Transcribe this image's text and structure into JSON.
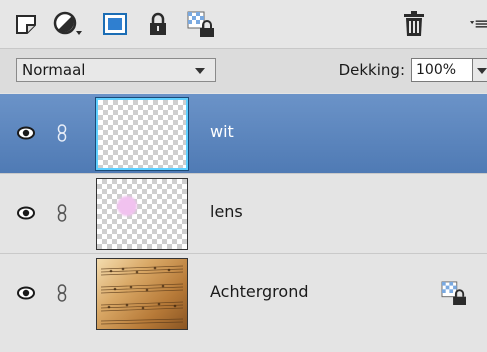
{
  "toolbar": {
    "icons": [
      "new-layer-icon",
      "adjustment-layer-icon",
      "layer-mask-icon",
      "lock-all-icon",
      "lock-transparency-icon",
      "delete-layer-icon",
      "panel-menu-icon"
    ]
  },
  "options": {
    "blend_mode": "Normaal",
    "opacity_label": "Dekking:",
    "opacity_value": "100%"
  },
  "layers": [
    {
      "name": "wit",
      "selected": true,
      "visible": true,
      "thumbnail": "transparent"
    },
    {
      "name": "lens",
      "selected": false,
      "visible": true,
      "thumbnail": "transparent-with-pink-spot"
    },
    {
      "name": "Achtergrond",
      "selected": false,
      "visible": true,
      "thumbnail": "sheet-music-photo",
      "locked": true
    }
  ],
  "colors": {
    "selected_row": "#5a84bd",
    "panel_bg": "#e4e4e4",
    "thumb_highlight": "#5fd0ff"
  }
}
